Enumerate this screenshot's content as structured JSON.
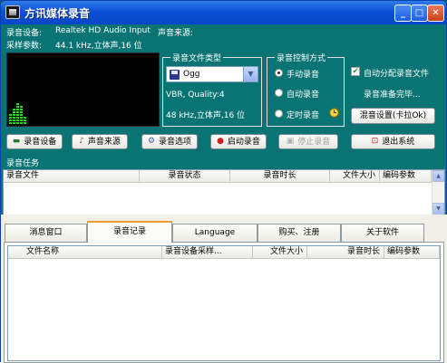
{
  "window": {
    "title": "方讯媒体录音"
  },
  "info": {
    "device_label": "录音设备:",
    "device_value": "Realtek HD Audio Input",
    "source_label": "声音来源:",
    "params_label": "采样参数:",
    "params_value": "44.1  kHz,立体声,16 位"
  },
  "format_group": {
    "title": "录音文件类型",
    "selected": "Ogg",
    "quality": "VBR, Quality:4",
    "params": "48  kHz,立体声,16 位"
  },
  "control_group": {
    "title": "录音控制方式",
    "options": [
      {
        "label": "手动录音",
        "selected": true
      },
      {
        "label": "自动录音",
        "selected": false
      },
      {
        "label": "定时录音",
        "selected": false
      }
    ],
    "clock_icon": "clock-icon"
  },
  "right_panel": {
    "auto_filename_label": "自动分配录音文件",
    "auto_filename_checked": true,
    "status_text": "录音准备完毕...",
    "mixer_button": "混音设置(卡拉Ok)"
  },
  "toolbar": [
    {
      "label": "录音设备",
      "icon": "device-icon",
      "disabled": false
    },
    {
      "label": "声音来源",
      "icon": "source-icon",
      "disabled": false
    },
    {
      "label": "录音选项",
      "icon": "options-icon",
      "disabled": false
    },
    {
      "label": "启动录音",
      "icon": "record-icon",
      "disabled": false
    },
    {
      "label": "停止录音",
      "icon": "stop-icon",
      "disabled": true
    },
    {
      "label": "退出系统",
      "icon": "exit-icon",
      "disabled": false
    }
  ],
  "tasks": {
    "title": "录音任务",
    "columns": [
      "录音文件",
      "录音状态",
      "录音时长",
      "文件大小",
      "编码参数"
    ]
  },
  "tabs": [
    {
      "label": "消息窗口",
      "active": false
    },
    {
      "label": "录音记录",
      "active": true
    },
    {
      "label": "Language",
      "active": false
    },
    {
      "label": "购买、注册",
      "active": false
    },
    {
      "label": "关于软件",
      "active": false
    }
  ],
  "records": {
    "columns": [
      "文件名称",
      "录音设备采样...",
      "文件大小",
      "录音时长",
      "编码参数"
    ]
  },
  "colors": {
    "background": "#0a7474",
    "title_bar": "#0a50d8",
    "meter": "#29d329"
  },
  "meter": {
    "levels": [
      0.15,
      0.22,
      0.3,
      0.26,
      0.12
    ]
  }
}
